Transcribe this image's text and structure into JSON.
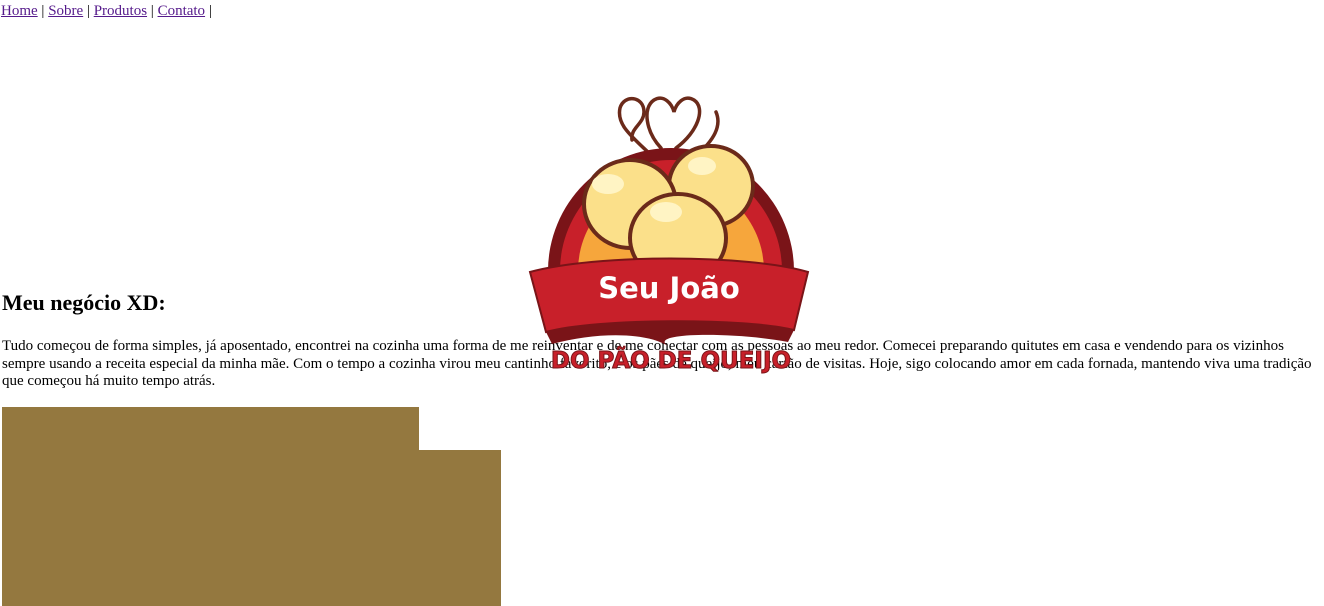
{
  "nav": {
    "items": [
      {
        "label": "Home",
        "sep": " | "
      },
      {
        "label": "Sobre",
        "sep": " | "
      },
      {
        "label": "Produtos",
        "sep": " | "
      },
      {
        "label": "Contato",
        "sep": " | "
      }
    ]
  },
  "logo": {
    "line1": "Seu João",
    "line2": "DO PÃO DE QUEIJO"
  },
  "main": {
    "heading": "Meu negócio XD:",
    "paragraph": "Tudo começou de forma simples, já aposentado, encontrei na cozinha uma forma de me reinventar e de me conectar com as pessoas ao meu redor. Comecei preparando quitutes em casa e vendendo para os vizinhos sempre usando a receita especial da minha mãe. Com o tempo a cozinha virou meu cantinho favorito, e os pães de queijo, meu cartão de visitas. Hoje, sigo colocando amor em cada fornada, mantendo viva uma tradição que começou há muito tempo atrás."
  },
  "colors": {
    "link": "#551a8b",
    "block": "#94783f",
    "logo_red": "#c8202a",
    "logo_dark": "#7a1418",
    "cheese_bread": "#fbe08a"
  }
}
